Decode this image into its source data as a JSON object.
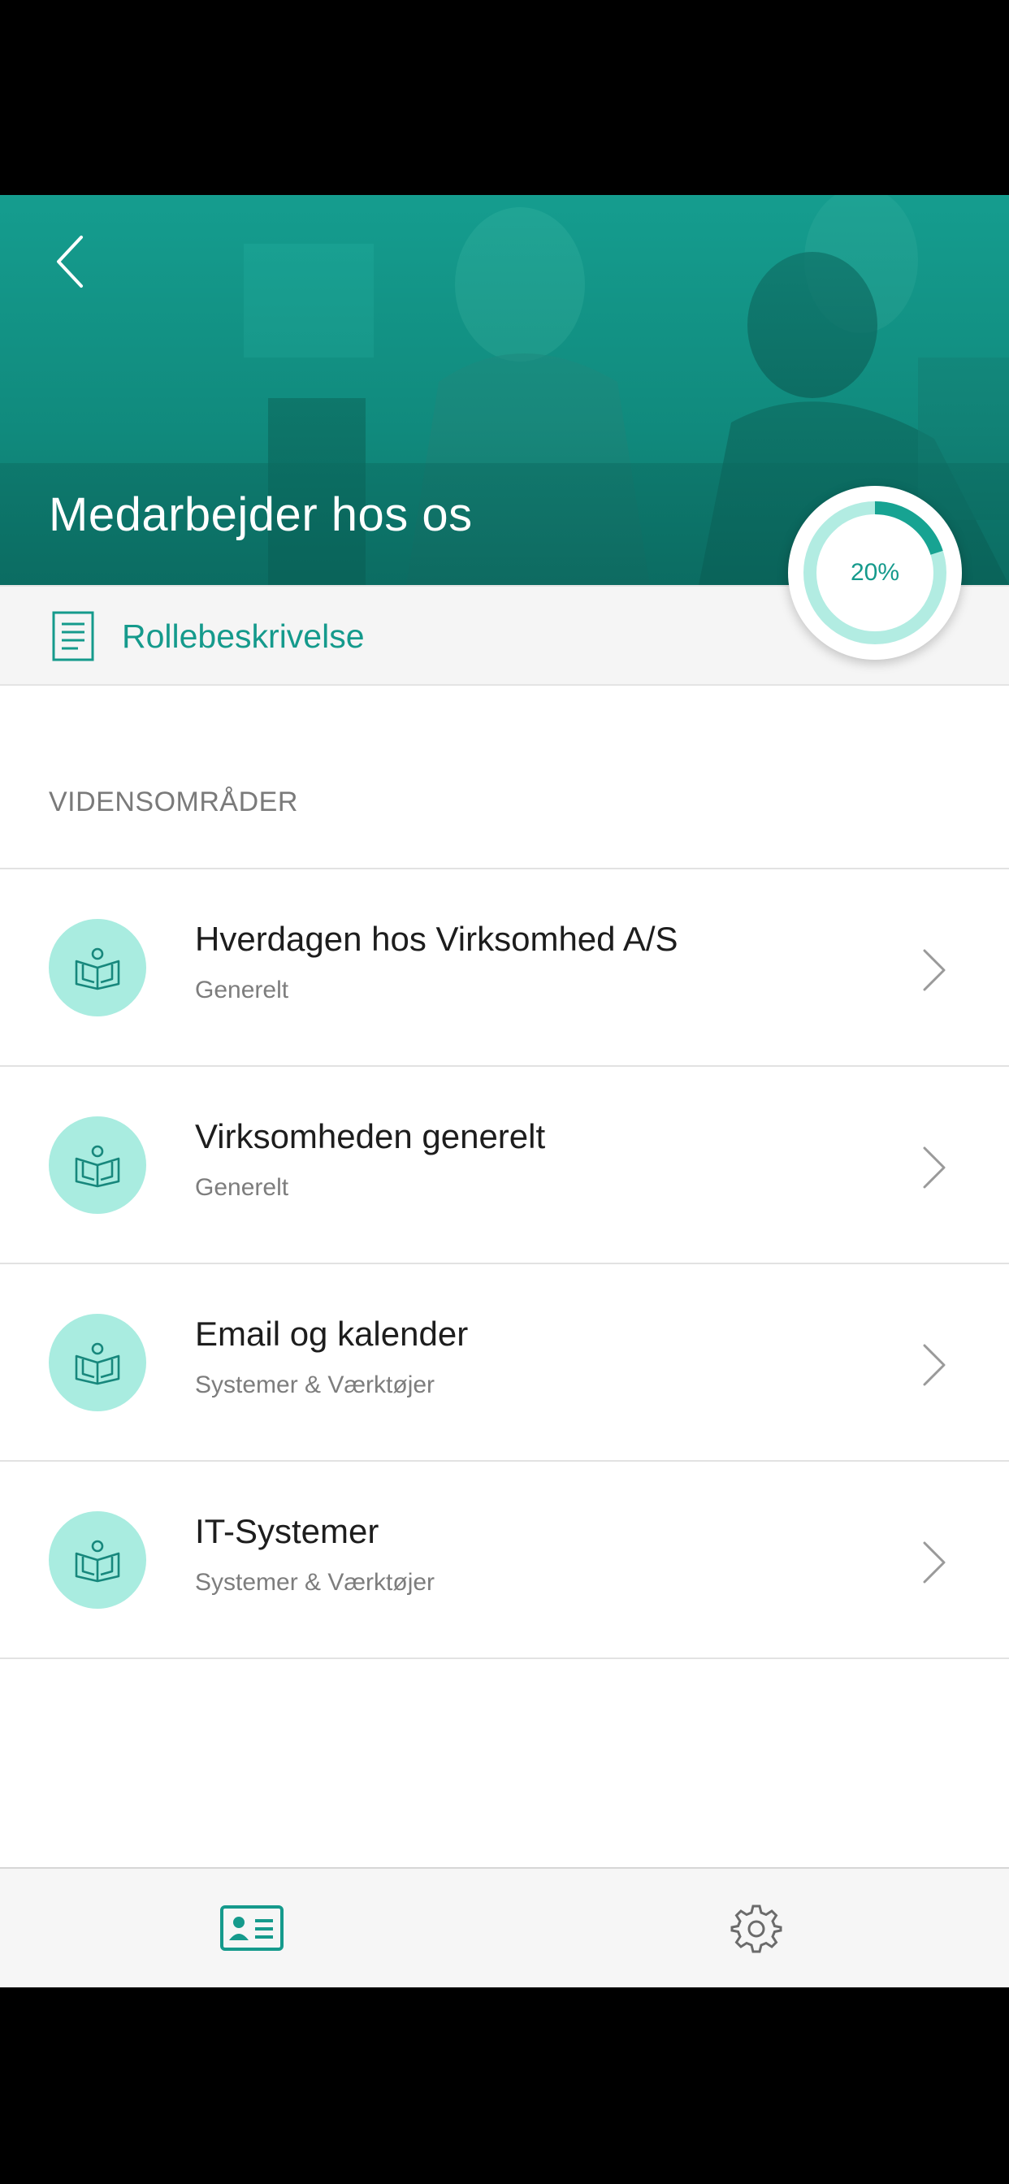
{
  "header": {
    "title": "Medarbejder hos os",
    "back_icon": "chevron-left-icon"
  },
  "progress": {
    "label": "20%",
    "value": 0.2,
    "track_color": "#b2ece2",
    "fill_color": "#17a392"
  },
  "role_link": {
    "label": "Rollebeskrivelse",
    "icon": "document-icon"
  },
  "section": {
    "title": "VIDENSOMRÅDER"
  },
  "items": [
    {
      "title": "Hverdagen hos Virksomhed A/S",
      "subtitle": "Generelt",
      "icon": "book-reader-icon"
    },
    {
      "title": "Virksomheden generelt",
      "subtitle": "Generelt",
      "icon": "book-reader-icon"
    },
    {
      "title": "Email og kalender",
      "subtitle": "Systemer & Værktøjer",
      "icon": "book-reader-icon"
    },
    {
      "title": "IT-Systemer",
      "subtitle": "Systemer & Værktøjer",
      "icon": "book-reader-icon"
    }
  ],
  "tabbar": {
    "tabs": [
      {
        "name": "profile",
        "icon": "id-card-icon",
        "active": true
      },
      {
        "name": "settings",
        "icon": "gear-icon",
        "active": false
      }
    ]
  },
  "colors": {
    "accent": "#159a8c",
    "icon_bg": "#a9ece0"
  }
}
